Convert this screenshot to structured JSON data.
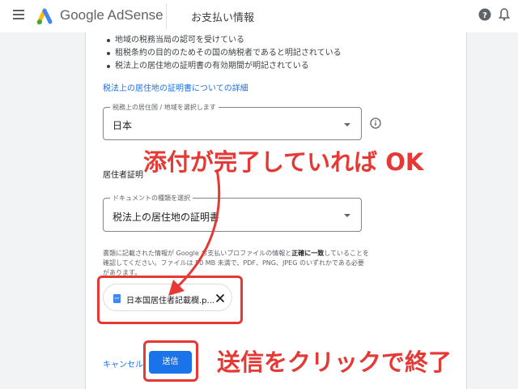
{
  "app": {
    "brand": "Google AdSense",
    "page_title": "お支払い情報"
  },
  "icons": {
    "menu": "menu-icon",
    "logo": "adsense-logo",
    "help": "help-icon",
    "notifications": "bell-icon",
    "info": "info-icon",
    "pdf": "pdf-file-icon",
    "close": "close-icon"
  },
  "requirements": {
    "items": [
      "地域の税務当局の認可を受けている",
      "租税条約の目的のためその国の納税者であると明記されている",
      "税法上の居住地の証明書の有効期間が明記されている"
    ],
    "details_link": "税法上の居住地の証明書についての詳細"
  },
  "country_select": {
    "label": "税務上の居住国 / 地域を選択します",
    "value": "日本"
  },
  "residency": {
    "section_label": "居住者証明"
  },
  "document_select": {
    "label": "ドキュメントの種類を選択",
    "value": "税法上の居住地の証明書"
  },
  "description": {
    "part1": "書類に記載された情報が Google お支払いプロファイルの情報と",
    "bold": "正確に一致",
    "part2": "していることを確認してください。ファイルは 50 MB 未満で、PDF、PNG、JPEG のいずれかである必要があります。"
  },
  "file_chip": {
    "name": "日本国居住者記載欄.p..."
  },
  "annotations": {
    "callout_upload": "添付が完了していれば OK",
    "callout_submit": "送信をクリックで終了"
  },
  "actions": {
    "cancel_label": "キャンセル",
    "submit_label": "送信"
  },
  "colors": {
    "accent": "#1a73e8",
    "annotation": "#e53935"
  }
}
